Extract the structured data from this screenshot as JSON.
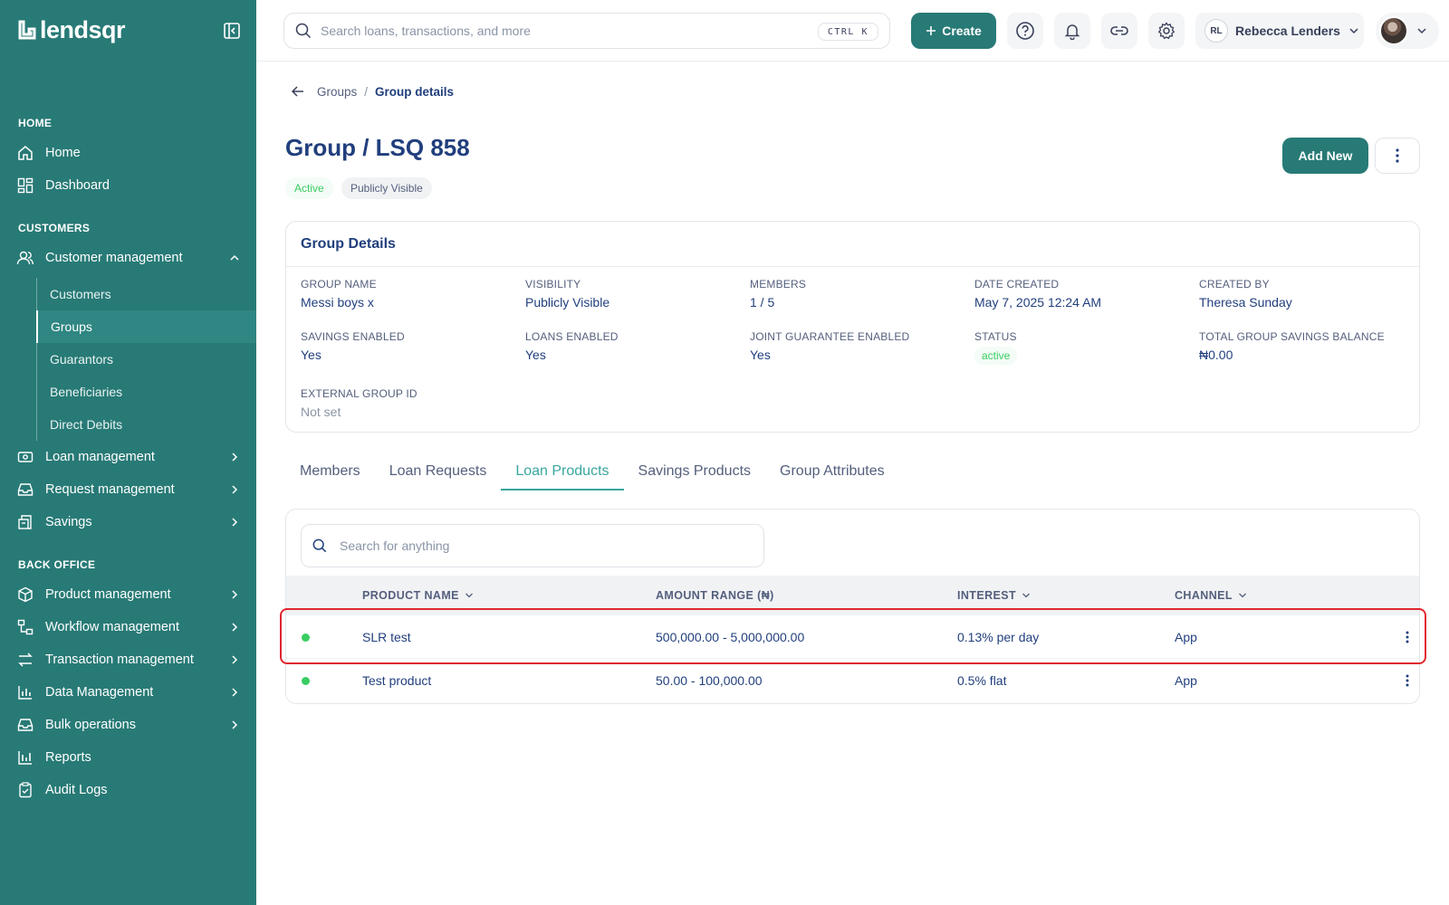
{
  "app": {
    "logo_text": "lendsqr"
  },
  "topbar": {
    "search_placeholder": "Search loans, transactions, and more",
    "shortcut": "CTRL K",
    "create_label": "Create",
    "user_initials": "RL",
    "user_name": "Rebecca Lenders"
  },
  "sidebar": {
    "sections": {
      "home": "HOME",
      "customers": "CUSTOMERS",
      "back_office": "BACK OFFICE"
    },
    "items": {
      "home": "Home",
      "dashboard": "Dashboard",
      "customer_management": "Customer management",
      "loan_management": "Loan management",
      "request_management": "Request management",
      "savings": "Savings",
      "product_management": "Product management",
      "workflow_management": "Workflow management",
      "transaction_management": "Transaction management",
      "data_management": "Data Management",
      "bulk_operations": "Bulk operations",
      "reports": "Reports",
      "audit_logs": "Audit Logs"
    },
    "sub_items": [
      "Customers",
      "Groups",
      "Guarantors",
      "Beneficiaries",
      "Direct Debits"
    ],
    "active_sub": "Groups"
  },
  "breadcrumb": {
    "parent": "Groups",
    "sep": "/",
    "current": "Group details"
  },
  "page": {
    "title": "Group / LSQ 858",
    "badge_status": "Active",
    "badge_visibility": "Publicly Visible",
    "add_new_label": "Add New"
  },
  "details": {
    "title": "Group Details",
    "fields": [
      {
        "label": "Group Name",
        "value": "Messi boys x"
      },
      {
        "label": "Visibility",
        "value": "Publicly Visible"
      },
      {
        "label": "Members",
        "value": "1 / 5"
      },
      {
        "label": "Date Created",
        "value": "May 7, 2025 12:24 AM"
      },
      {
        "label": "Created By",
        "value": "Theresa Sunday"
      },
      {
        "label": "Savings Enabled",
        "value": "Yes"
      },
      {
        "label": "Loans Enabled",
        "value": "Yes"
      },
      {
        "label": "Joint Guarantee Enabled",
        "value": "Yes"
      },
      {
        "label": "Status",
        "value": "active"
      },
      {
        "label": "Total Group Savings Balance",
        "value": "₦0.00"
      },
      {
        "label": "External Group ID",
        "value": "Not set"
      }
    ]
  },
  "tabs": [
    "Members",
    "Loan Requests",
    "Loan Products",
    "Savings Products",
    "Group Attributes"
  ],
  "active_tab": "Loan Products",
  "table": {
    "search_placeholder": "Search for anything",
    "headers": [
      "PRODUCT NAME",
      "AMOUNT RANGE (₦)",
      "INTEREST",
      "CHANNEL"
    ],
    "rows": [
      {
        "name": "SLR test",
        "amount": "500,000.00 - 5,000,000.00",
        "interest": "0.13% per day",
        "channel": "App"
      },
      {
        "name": "Test product",
        "amount": "50.00 - 100,000.00",
        "interest": "0.5% flat",
        "channel": "App"
      }
    ]
  },
  "colors": {
    "brand": "#287a76",
    "accent": "#39a6a0",
    "text": "#213f7d",
    "success": "#39cd62",
    "highlight": "#e0262d"
  }
}
